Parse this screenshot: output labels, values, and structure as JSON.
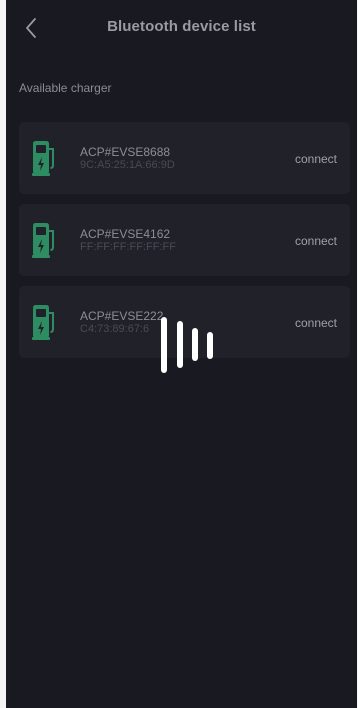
{
  "header": {
    "title": "Bluetooth device list",
    "back_icon": "chevron-left-icon"
  },
  "section": {
    "label": "Available charger"
  },
  "devices": [
    {
      "name": "ACP#EVSE8688",
      "mac": "9C:A5:25:1A:66:9D",
      "action": "connect",
      "icon": "ev-charger-icon"
    },
    {
      "name": "ACP#EVSE4162",
      "mac": "FF:FF:FF:FF:FF:FF",
      "action": "connect",
      "icon": "ev-charger-icon"
    },
    {
      "name": "ACP#EVSE222",
      "mac": "C4:73:89:67:6",
      "action": "connect",
      "icon": "ev-charger-icon"
    }
  ],
  "loading_indicator": {
    "icon": "loading-bars-icon"
  },
  "colors": {
    "screen_background": "#191921",
    "card_background": "#21212a",
    "charger_green": "#2d8c62",
    "text_primary": "#9a9aa3",
    "text_secondary": "#4a4a53",
    "loader_white": "#ffffff"
  }
}
